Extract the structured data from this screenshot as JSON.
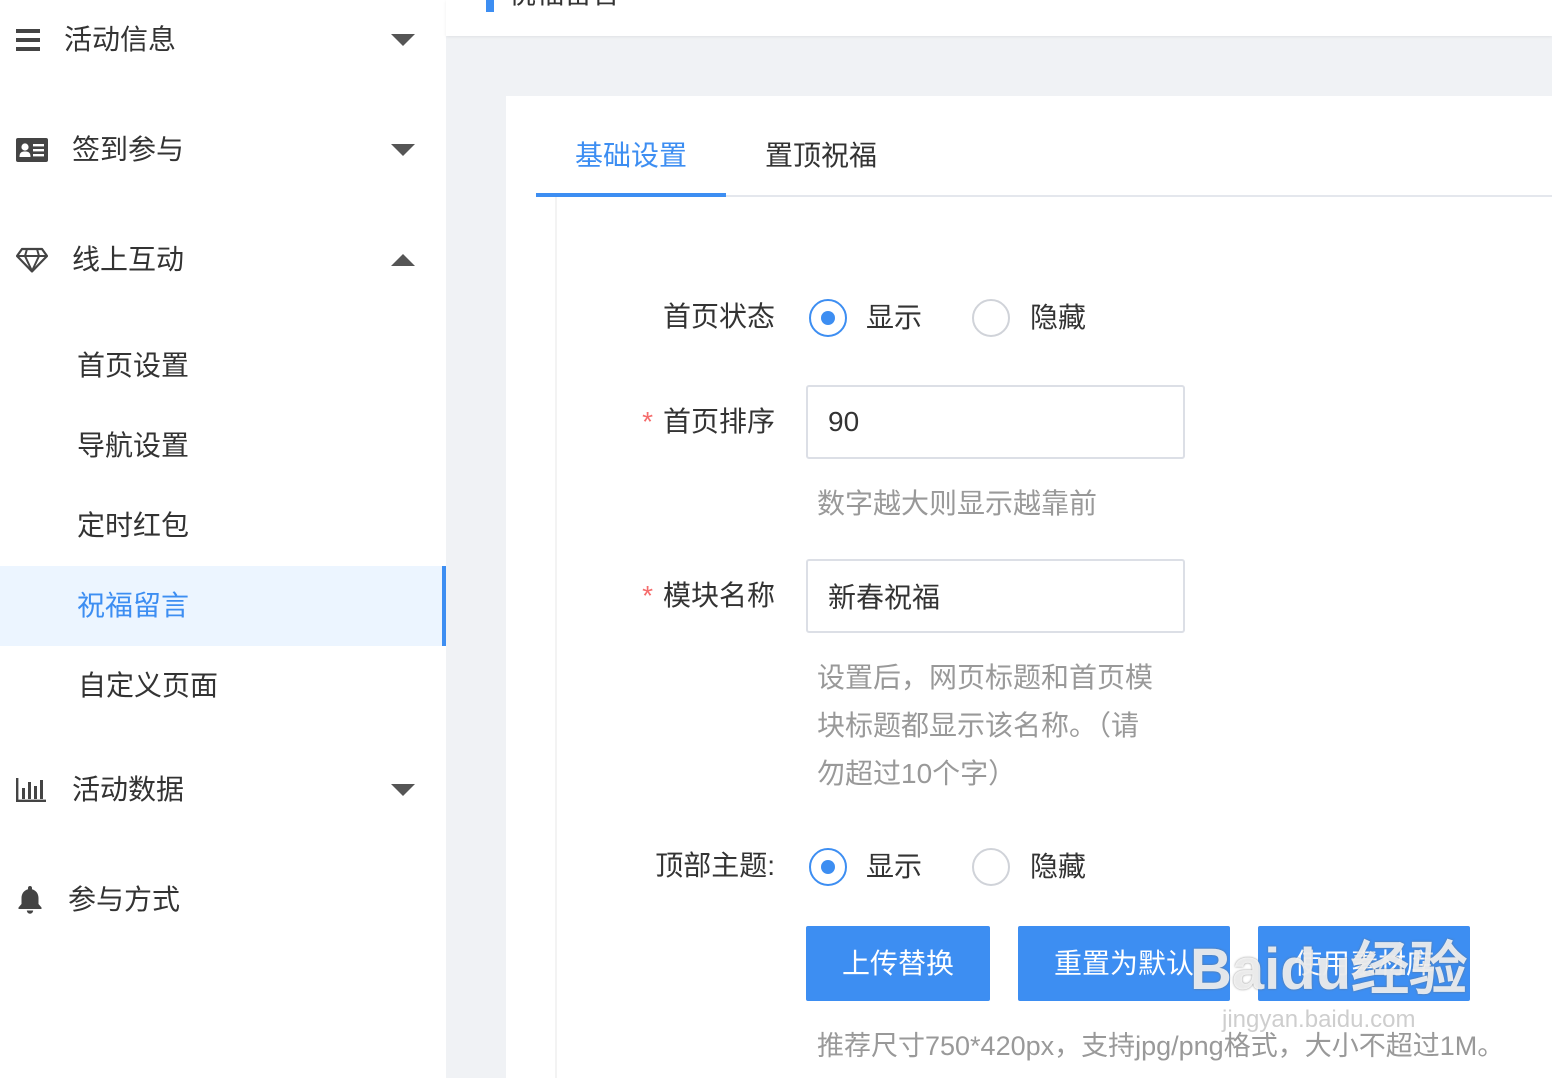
{
  "header": {
    "title": "祝福留言"
  },
  "sidebar": {
    "items": [
      {
        "label": "活动信息",
        "icon": "menu-icon",
        "expanded": false
      },
      {
        "label": "签到参与",
        "icon": "id-card-icon",
        "expanded": false
      },
      {
        "label": "线上互动",
        "icon": "diamond-icon",
        "expanded": true,
        "children": [
          {
            "label": "首页设置",
            "active": false
          },
          {
            "label": "导航设置",
            "active": false
          },
          {
            "label": "定时红包",
            "active": false
          },
          {
            "label": "祝福留言",
            "active": true
          },
          {
            "label": "自定义页面",
            "active": false
          }
        ]
      },
      {
        "label": "活动数据",
        "icon": "bar-chart-icon",
        "expanded": false
      },
      {
        "label": "参与方式",
        "icon": "bell-icon"
      }
    ]
  },
  "tabs": [
    {
      "label": "基础设置",
      "active": true
    },
    {
      "label": "置顶祝福",
      "active": false
    }
  ],
  "form": {
    "required_mark": "*",
    "home_status": {
      "label": "首页状态",
      "options": [
        "显示",
        "隐藏"
      ],
      "selected_index": 0
    },
    "home_order": {
      "label": "首页排序",
      "required": true,
      "value": "90",
      "hint": "数字越大则显示越靠前"
    },
    "module_name": {
      "label": "模块名称",
      "required": true,
      "value": "新春祝福",
      "hint": "设置后，网页标题和首页模块标题都显示该名称。（请勿超过10个字）"
    },
    "top_theme": {
      "label": "顶部主题:",
      "options": [
        "显示",
        "隐藏"
      ],
      "selected_index": 0,
      "buttons": {
        "upload": "上传替换",
        "reset": "重置为默认",
        "library": "使用素材库"
      },
      "hint": "推荐尺寸750*420px，支持jpg/png格式，大小不超过1M。"
    }
  },
  "colors": {
    "accent": "#3d8ef2",
    "required": "#f56c6c",
    "hint": "#999999",
    "active_bg": "#ecf5ff",
    "page_bg": "#f0f2f5"
  },
  "watermark": {
    "logo_text": "Baidu经验",
    "site": "jingyan.baidu.com"
  }
}
